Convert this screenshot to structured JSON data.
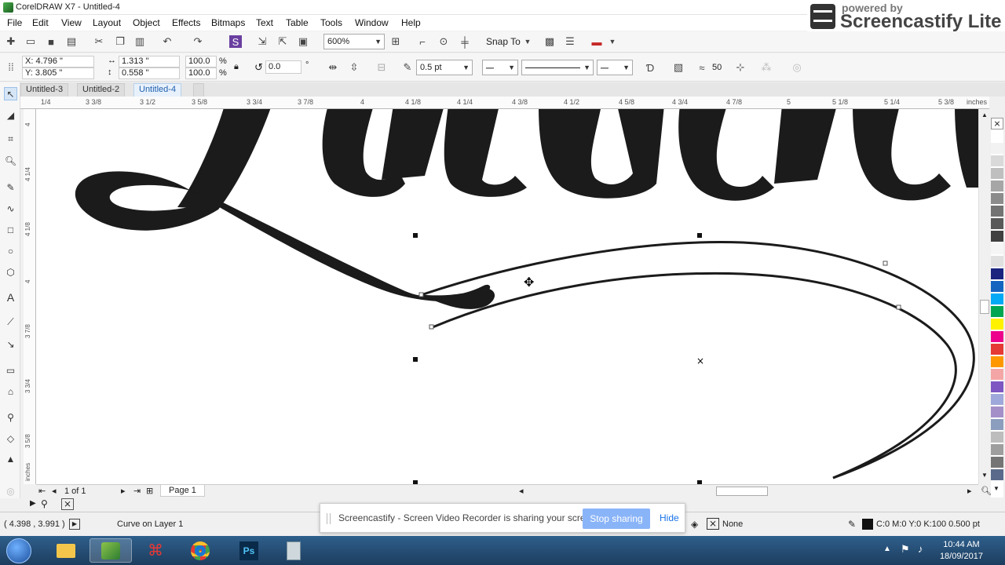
{
  "window": {
    "title": "CorelDRAW X7 - Untitled-4"
  },
  "badge": {
    "pre": "powered by",
    "brand": "Screencastify Lite"
  },
  "menu": [
    "File",
    "Edit",
    "View",
    "Layout",
    "Object",
    "Effects",
    "Bitmaps",
    "Text",
    "Table",
    "Tools",
    "Window",
    "Help"
  ],
  "toolbar": {
    "zoom": "600%",
    "snap": "Snap To"
  },
  "props": {
    "x": "X: 4.796 \"",
    "y": "Y: 3.805 \"",
    "w": "1.313 \"",
    "h": "0.558 \"",
    "sx": "100.0",
    "sy": "100.0",
    "pct": "%",
    "angle": "0.0",
    "deg": "°",
    "outline": "0.5 pt",
    "nodes": "50"
  },
  "tabs": [
    "Untitled-3",
    "Untitled-2",
    "Untitled-4"
  ],
  "ruler": {
    "h": [
      "1/4",
      "3 3/8",
      "3 1/2",
      "3 5/8",
      "3 3/4",
      "3 7/8",
      "4",
      "4 1/8",
      "4 1/4",
      "4 3/8",
      "4 1/2",
      "4 5/8",
      "4 3/4",
      "4 7/8",
      "5",
      "5 1/8",
      "5 1/4",
      "5 3/8",
      "inches"
    ],
    "v": [
      "4",
      "4 1/4",
      "4 1/8",
      "4",
      "3 7/8",
      "3 3/4",
      "3 5/8",
      "inches"
    ]
  },
  "pagenav": {
    "count": "1 of 1",
    "page": "Page 1"
  },
  "status": {
    "coords": "( 4.398 , 3.991 )",
    "object": "Curve on Layer 1",
    "fill": "None",
    "outline": "C:0 M:0 Y:0 K:100  0.500 pt"
  },
  "share": {
    "message": "Screencastify - Screen Video Recorder is sharing your screen.",
    "stop": "Stop sharing",
    "hide": "Hide"
  },
  "clock": {
    "time": "10:44 AM",
    "date": "18/09/2017"
  },
  "palette": [
    "#1a237e",
    "#1565c0",
    "#03a9f4",
    "#00acc1",
    "#00a651",
    "#8bc34a",
    "#fff200",
    "#f44336",
    "#e91e63",
    "#ec008c",
    "#ff9800",
    "#f4a6a6",
    "#7e57c2",
    "#9fa8da",
    "#a48fc9",
    "#8c9ebd",
    "#bdbdbd",
    "#9e9e9e",
    "#757575"
  ],
  "colors": {
    "ink": "#1b1b1b",
    "accent": "#1f5fb0"
  }
}
